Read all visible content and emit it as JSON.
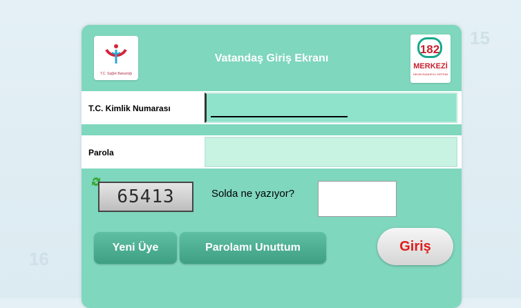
{
  "header": {
    "title": "Vatandaş Giriş Ekranı",
    "left_logo_caption": "T.C. Sağlık Bakanlığı",
    "right_logo_number": "182",
    "right_logo_text": "MERKEZİ",
    "right_logo_subtext": "HEKİM RANDEVU SİSTEMİ"
  },
  "form": {
    "tc_label": "T.C. Kimlik Numarası",
    "password_label": "Parola",
    "captcha_code": "65413",
    "captcha_question": "Solda ne yazıyor?"
  },
  "buttons": {
    "new_member": "Yeni Üye",
    "forgot_password": "Parolamı Unuttum",
    "login": "Giriş"
  },
  "background_numbers": [
    "15",
    "16"
  ],
  "colors": {
    "panel": "#7fd7bd",
    "button": "#3e9f83",
    "login_text": "#e01c1c"
  },
  "icons": [
    "ministry-logo-icon",
    "merkezi-182-logo-icon",
    "captcha-refresh-icon"
  ]
}
